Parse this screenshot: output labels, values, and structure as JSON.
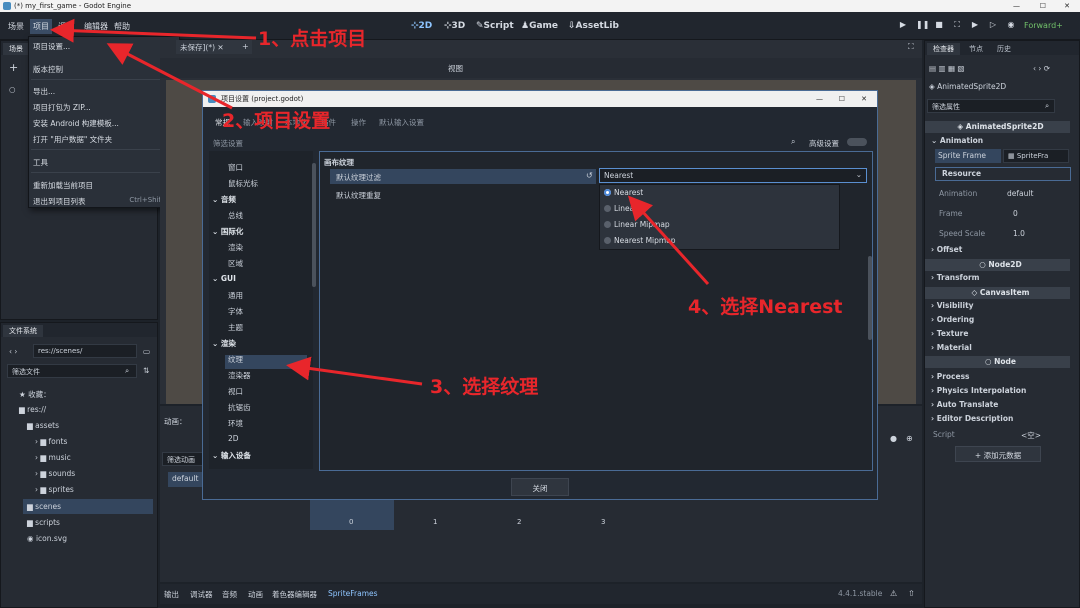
{
  "window": {
    "title": "(*) my_first_game - Godot Engine"
  },
  "menu": {
    "scene": "场景",
    "project": "项目",
    "debug": "调试",
    "editor": "编辑器",
    "help": "帮助"
  },
  "modes": {
    "m2d": "2D",
    "m3d": "3D",
    "script": "Script",
    "game": "Game",
    "assetlib": "AssetLib"
  },
  "renderer": "Forward+",
  "project_menu": {
    "items": [
      "项目设置...",
      "版本控制",
      "导出...",
      "项目打包为 ZIP...",
      "安装 Android 构建模板...",
      "打开 \"用户数据\" 文件夹",
      "工具",
      "重新加载当前项目",
      "退出到项目列表"
    ],
    "quit_shortcut": "Ctrl+Shift+Q"
  },
  "scene_dock": {
    "tab": "场景"
  },
  "editor_tab": {
    "label": "未保存](*)"
  },
  "viewport_toolbar": {
    "view": "视图"
  },
  "filesystem": {
    "tab": "文件系统",
    "path": "res://scenes/",
    "filter_placeholder": "筛选文件",
    "favorites": "收藏：",
    "root": "res://",
    "items": [
      "assets",
      "fonts",
      "music",
      "sounds",
      "sprites",
      "scenes",
      "scripts",
      "icon.svg"
    ]
  },
  "animation_panel": {
    "label": "动画：",
    "filter": "筛选动画",
    "default": "default",
    "frames": [
      "0",
      "1",
      "2",
      "3"
    ]
  },
  "bottom_bar": {
    "items": [
      "输出",
      "调试器",
      "音频",
      "动画",
      "着色器编辑器",
      "SpriteFrames"
    ],
    "version": "4.4.1.stable"
  },
  "inspector": {
    "tabs": [
      "检查器",
      "节点",
      "历史"
    ],
    "node_selector": "AnimatedSprite2D",
    "filter_placeholder": "筛选属性",
    "class_header": "AnimatedSprite2D",
    "animation_section": "Animation",
    "sprite_frames_label": "Sprite Frame",
    "sprite_frames_value": "SpriteFra",
    "resource": "Resource",
    "anim_label": "Animation",
    "anim_value": "default",
    "frame_label": "Frame",
    "frame_value": "0",
    "speed_label": "Speed Scale",
    "speed_value": "1.0",
    "offset": "Offset",
    "node2d": "Node2D",
    "transform": "Transform",
    "canvasitem": "CanvasItem",
    "visibility": "Visibility",
    "ordering": "Ordering",
    "texture": "Texture",
    "material": "Material",
    "node": "Node",
    "process": "Process",
    "physics": "Physics Interpolation",
    "auto_translate": "Auto Translate",
    "description": "Editor Description",
    "script_label": "Script",
    "script_value": "<空>",
    "add_metadata": "添加元数据"
  },
  "dialog": {
    "title": "项目设置 (project.godot)",
    "tabs": [
      "常规",
      "输入映射",
      "本地化",
      "插件",
      "操作",
      "默认输入设置"
    ],
    "filter_placeholder": "筛选设置",
    "advanced": "高级设置",
    "tree": [
      {
        "label": "窗口",
        "head": false
      },
      {
        "label": "鼠标光标",
        "head": false
      },
      {
        "label": "音频",
        "head": true
      },
      {
        "label": "总线",
        "head": false
      },
      {
        "label": "国际化",
        "head": true
      },
      {
        "label": "渲染",
        "head": false
      },
      {
        "label": "区域",
        "head": false
      },
      {
        "label": "GUI",
        "head": true
      },
      {
        "label": "通用",
        "head": false
      },
      {
        "label": "字体",
        "head": false
      },
      {
        "label": "主题",
        "head": false
      },
      {
        "label": "渲染",
        "head": true
      },
      {
        "label": "纹理",
        "head": false
      },
      {
        "label": "渲染器",
        "head": false
      },
      {
        "label": "视口",
        "head": false
      },
      {
        "label": "抗锯齿",
        "head": false
      },
      {
        "label": "环境",
        "head": false
      },
      {
        "label": "2D",
        "head": false
      },
      {
        "label": "输入设备",
        "head": true
      }
    ],
    "section": "画布纹理",
    "setting1": "默认纹理过滤",
    "setting2": "默认纹理重复",
    "dropdown_value": "Nearest",
    "options": [
      "Nearest",
      "Linear",
      "Linear Mipmap",
      "Nearest Mipmap"
    ],
    "close": "关闭"
  },
  "annotations": {
    "a1": "1、点击项目",
    "a2": "2、项目设置",
    "a3": "3、选择纹理",
    "a4": "4、选择Nearest",
    "color": "#e8262b"
  }
}
